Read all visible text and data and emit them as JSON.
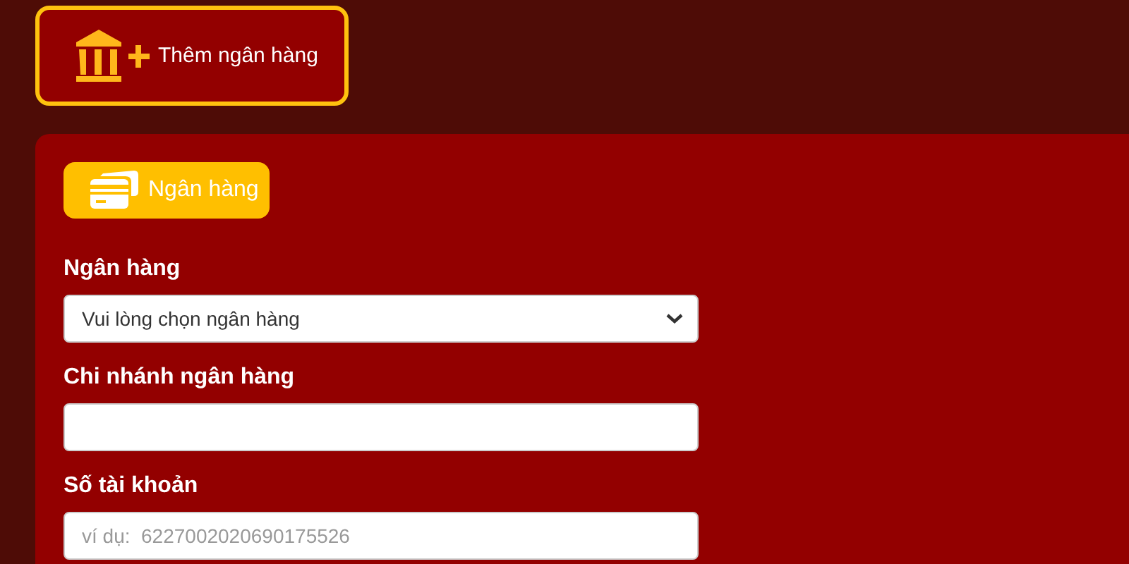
{
  "add_bank_button": {
    "label": "Thêm ngân hàng"
  },
  "section_tab": {
    "label": "Ngân hàng"
  },
  "form": {
    "fields": [
      {
        "kind": "select",
        "label": "Ngân hàng",
        "value": "Vui lòng chọn ngân hàng"
      },
      {
        "kind": "text",
        "label": "Chi nhánh ngân hàng"
      },
      {
        "kind": "text",
        "label": "Số tài khoản",
        "placeholder": "ví dụ:  6227002020690175526"
      }
    ]
  }
}
